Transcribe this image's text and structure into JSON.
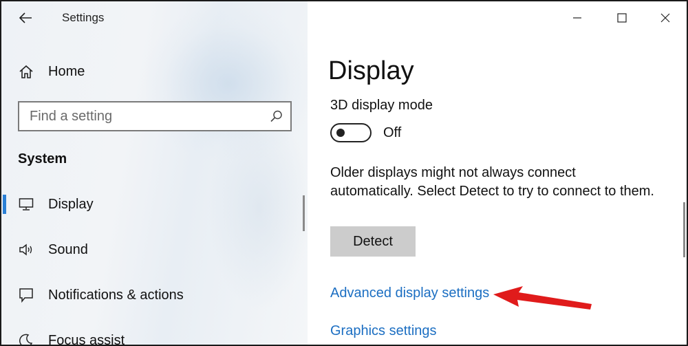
{
  "window": {
    "app_title": "Settings"
  },
  "sidebar": {
    "home_label": "Home",
    "search_placeholder": "Find a setting",
    "section_title": "System",
    "items": [
      {
        "label": "Display",
        "icon": "monitor-icon",
        "selected": true
      },
      {
        "label": "Sound",
        "icon": "speaker-icon",
        "selected": false
      },
      {
        "label": "Notifications & actions",
        "icon": "notification-icon",
        "selected": false
      },
      {
        "label": "Focus assist",
        "icon": "moon-icon",
        "selected": false
      }
    ]
  },
  "main": {
    "page_title": "Display",
    "mode_label": "3D display mode",
    "toggle_state": "Off",
    "description": "Older displays might not always connect automatically. Select Detect to try to connect to them.",
    "detect_button": "Detect",
    "advanced_link": "Advanced display settings",
    "graphics_link": "Graphics settings"
  },
  "colors": {
    "accent": "#2a7fd4",
    "link": "#1b6ec2",
    "annotation_arrow": "#e01b1b",
    "button_bg": "#cccccc"
  }
}
